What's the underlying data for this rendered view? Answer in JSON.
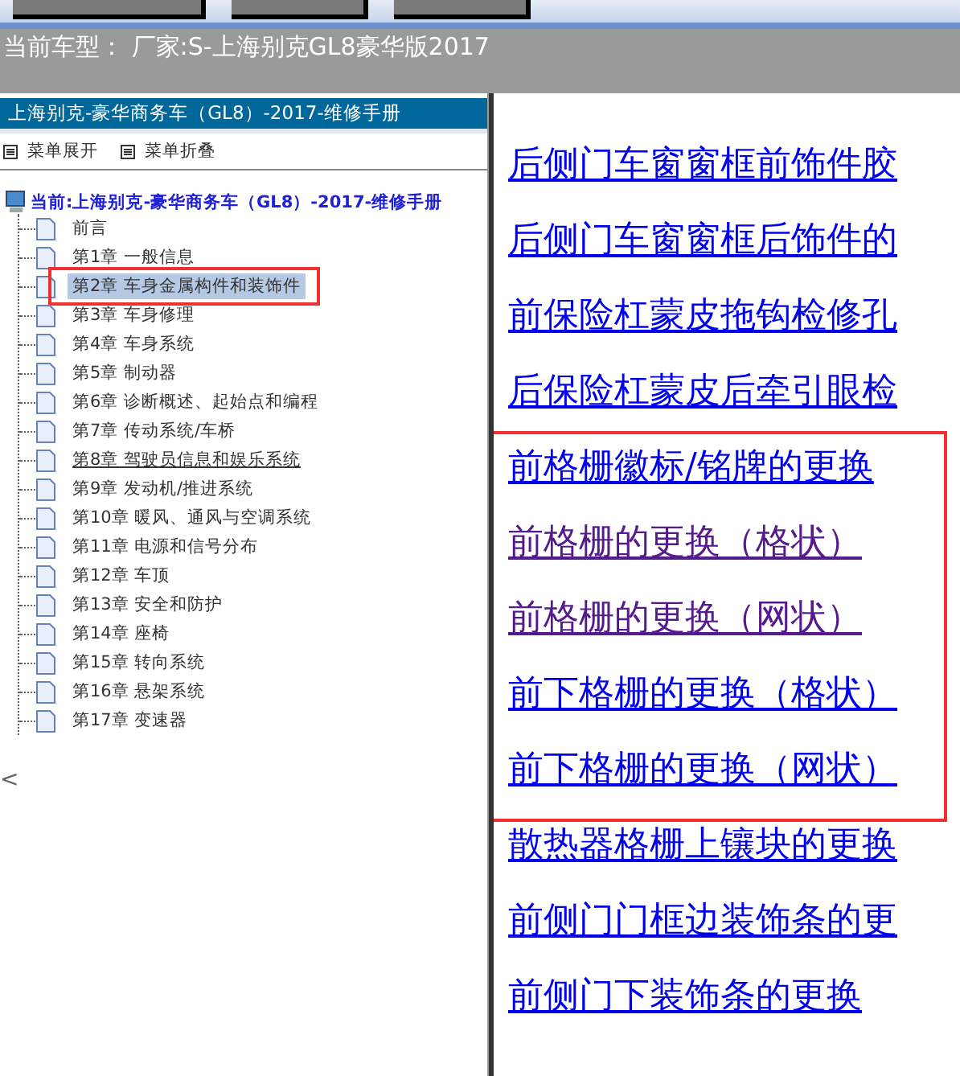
{
  "toolbar": {
    "buttons": [
      {
        "kind": "wide"
      },
      {
        "kind": "narrow"
      },
      {
        "kind": "narrow"
      }
    ]
  },
  "current_model": "当前车型：  厂家:S-上海别克GL8豪华版2017",
  "sidebar": {
    "title": "上海别克-豪华商务车（GL8）-2017-维修手册",
    "menu": [
      "菜单展开",
      "菜单折叠"
    ],
    "tree": {
      "label": "当前:上海别克-豪华商务车（GL8）-2017-维修手册",
      "children": [
        {
          "label": "前言",
          "selected": false,
          "hovered": false
        },
        {
          "label": "第1章 一般信息",
          "selected": false,
          "hovered": false
        },
        {
          "label": "第2章 车身金属构件和装饰件",
          "selected": true,
          "hovered": false
        },
        {
          "label": "第3章 车身修理",
          "selected": false,
          "hovered": false
        },
        {
          "label": "第4章 车身系统",
          "selected": false,
          "hovered": false
        },
        {
          "label": "第5章 制动器",
          "selected": false,
          "hovered": false
        },
        {
          "label": "第6章 诊断概述、起始点和编程",
          "selected": false,
          "hovered": false
        },
        {
          "label": "第7章 传动系统/车桥",
          "selected": false,
          "hovered": false
        },
        {
          "label": "第8章 驾驶员信息和娱乐系统",
          "selected": false,
          "hovered": true
        },
        {
          "label": "第9章 发动机/推进系统",
          "selected": false,
          "hovered": false
        },
        {
          "label": "第10章 暖风、通风与空调系统",
          "selected": false,
          "hovered": false
        },
        {
          "label": "第11章 电源和信号分布",
          "selected": false,
          "hovered": false
        },
        {
          "label": "第12章 车顶",
          "selected": false,
          "hovered": false
        },
        {
          "label": "第13章 安全和防护",
          "selected": false,
          "hovered": false
        },
        {
          "label": "第14章 座椅",
          "selected": false,
          "hovered": false
        },
        {
          "label": "第15章 转向系统",
          "selected": false,
          "hovered": false
        },
        {
          "label": "第16章 悬架系统",
          "selected": false,
          "hovered": false
        },
        {
          "label": "第17章 变速器",
          "selected": false,
          "hovered": false
        }
      ]
    },
    "scroll_hint": "<"
  },
  "links": [
    {
      "label": "后侧门车窗窗框前饰件胶",
      "visited": false,
      "marked": false
    },
    {
      "label": "后侧门车窗窗框后饰件的",
      "visited": false,
      "marked": false
    },
    {
      "label": "前保险杠蒙皮拖钩检修孔",
      "visited": false,
      "marked": false
    },
    {
      "label": "后保险杠蒙皮后牵引眼检",
      "visited": false,
      "marked": false
    },
    {
      "label": "前格栅徽标/铭牌的更换",
      "visited": false,
      "marked": true
    },
    {
      "label": "前格栅的更换（格状）",
      "visited": true,
      "marked": true
    },
    {
      "label": "前格栅的更换（网状）",
      "visited": true,
      "marked": true
    },
    {
      "label": "前下格栅的更换（格状）",
      "visited": false,
      "marked": true
    },
    {
      "label": "前下格栅的更换（网状）",
      "visited": false,
      "marked": true
    },
    {
      "label": "散热器格栅上镶块的更换",
      "visited": false,
      "marked": false
    },
    {
      "label": "前侧门门框边装饰条的更",
      "visited": false,
      "marked": false
    },
    {
      "label": "前侧门下装饰条的更换",
      "visited": false,
      "marked": false
    }
  ]
}
